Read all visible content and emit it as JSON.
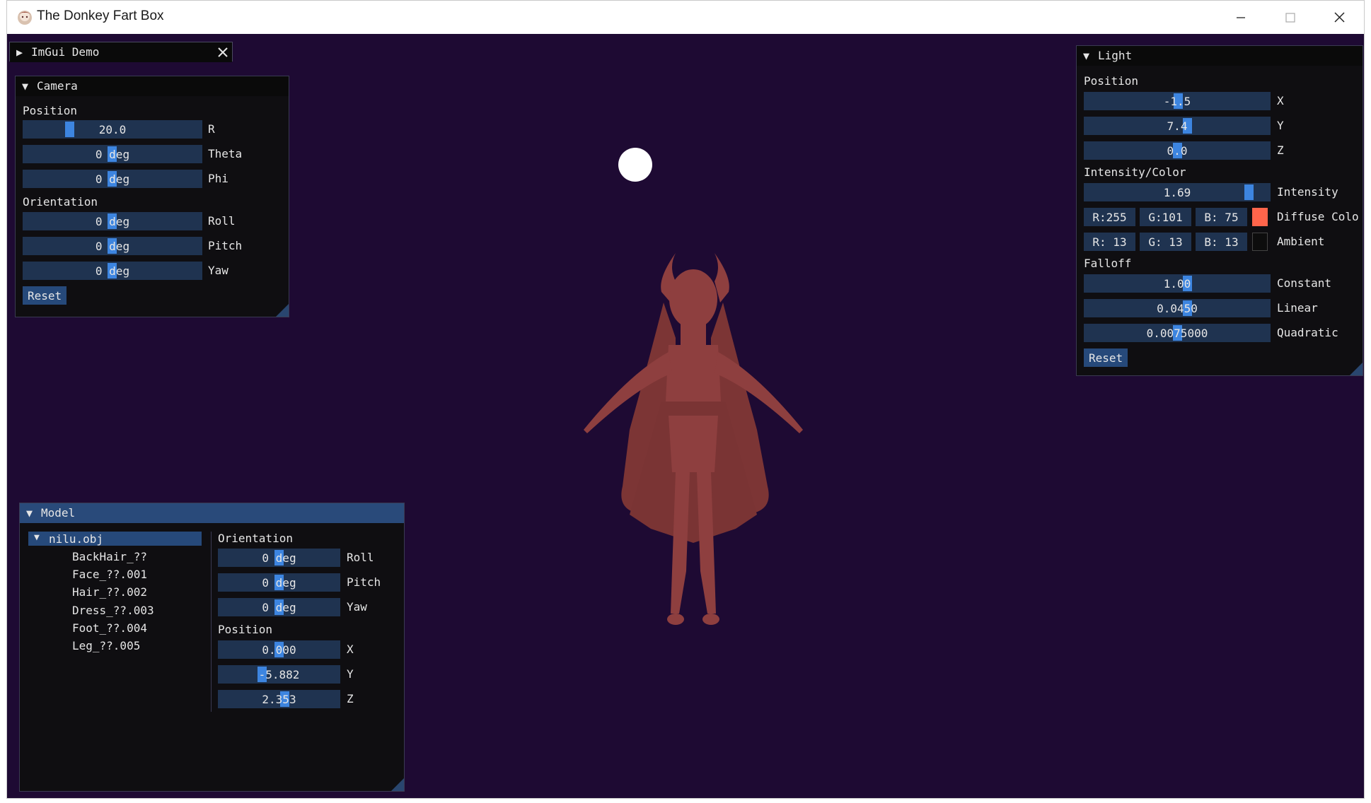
{
  "window": {
    "title": "The Donkey Fart Box",
    "minimize_icon": "minimize-icon",
    "maximize_icon": "maximize-icon",
    "close_icon": "close-icon"
  },
  "imgui_demo": {
    "title": "ImGui Demo",
    "arrow": "▶",
    "close_icon": "close-icon"
  },
  "camera": {
    "title": "Camera",
    "arrow": "▼",
    "position_label": "Position",
    "r": {
      "value": "20.0",
      "label": "R"
    },
    "theta": {
      "value": "0 deg",
      "label": "Theta"
    },
    "phi": {
      "value": "0 deg",
      "label": "Phi"
    },
    "orientation_label": "Orientation",
    "roll": {
      "value": "0 deg",
      "label": "Roll"
    },
    "pitch": {
      "value": "0 deg",
      "label": "Pitch"
    },
    "yaw": {
      "value": "0 deg",
      "label": "Yaw"
    },
    "reset_label": "Reset"
  },
  "light": {
    "title": "Light",
    "arrow": "▼",
    "position_label": "Position",
    "x": {
      "value": "-1.5",
      "label": "X"
    },
    "y": {
      "value": "7.4",
      "label": "Y"
    },
    "z": {
      "value": "0.0",
      "label": "Z"
    },
    "intensity_color_label": "Intensity/Color",
    "intensity": {
      "value": "1.69",
      "label": "Intensity"
    },
    "diffuse": {
      "r": "R:255",
      "g": "G:101",
      "b": "B: 75",
      "label": "Diffuse Colo",
      "swatch": "#ff654b"
    },
    "ambient": {
      "r": "R: 13",
      "g": "G: 13",
      "b": "B: 13",
      "label": "Ambient",
      "swatch": "#0d0d0d"
    },
    "falloff_label": "Falloff",
    "constant": {
      "value": "1.00",
      "label": "Constant"
    },
    "linear": {
      "value": "0.0450",
      "label": "Linear"
    },
    "quadratic": {
      "value": "0.0075000",
      "label": "Quadratic"
    },
    "reset_label": "Reset"
  },
  "model": {
    "title": "Model",
    "arrow": "▼",
    "tree": {
      "root_arrow": "▼",
      "root": "nilu.obj",
      "children": [
        "BackHair_??",
        "Face_??.001",
        "Hair_??.002",
        "Dress_??.003",
        "Foot_??.004",
        "Leg_??.005"
      ]
    },
    "orientation_label": "Orientation",
    "roll": {
      "value": "0 deg",
      "label": "Roll"
    },
    "pitch": {
      "value": "0 deg",
      "label": "Pitch"
    },
    "yaw": {
      "value": "0 deg",
      "label": "Yaw"
    },
    "position_label": "Position",
    "x": {
      "value": "0.000",
      "label": "X"
    },
    "y": {
      "value": "-5.882",
      "label": "Y"
    },
    "z": {
      "value": "2.353",
      "label": "Z"
    }
  },
  "colors": {
    "background": "#1e0a33",
    "model": "#8e3f3f",
    "light_source": "#ffffff",
    "accent": "#3d85e0",
    "field": "#1f3350",
    "title_active": "#294a7a"
  }
}
